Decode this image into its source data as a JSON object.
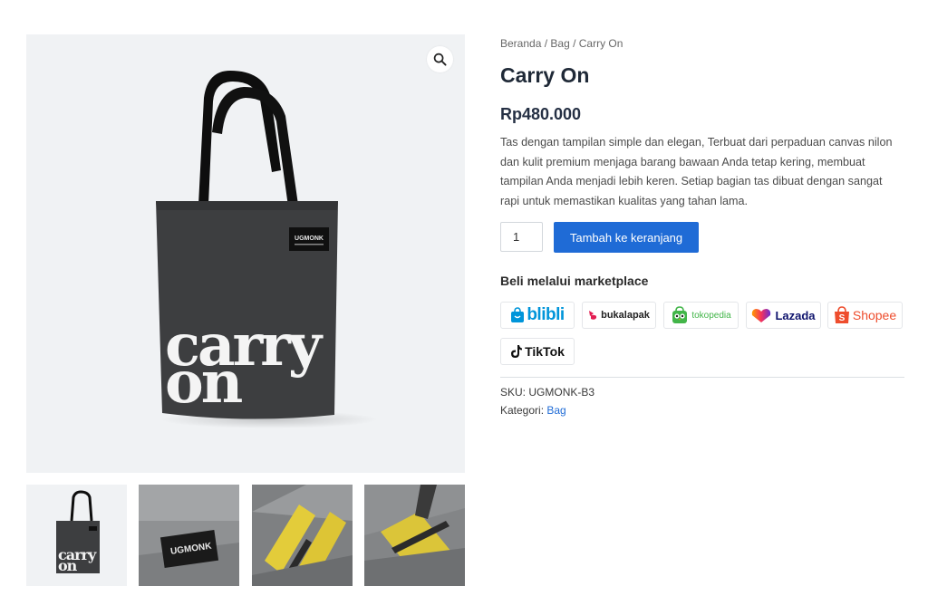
{
  "gallery": {
    "zoom_icon": "search-icon",
    "bag_brand_label": "UGMONK",
    "bag_print_line1": "carry",
    "bag_print_line2": "on"
  },
  "breadcrumb": {
    "home": "Beranda",
    "sep1": " / ",
    "category": "Bag",
    "sep2": " / ",
    "current": "Carry On"
  },
  "product": {
    "title": "Carry On",
    "price": "Rp480.000",
    "description": "Tas dengan tampilan simple dan elegan, Terbuat dari perpaduan canvas nilon dan kulit premium menjaga barang bawaan Anda tetap kering, membuat tampilan Anda menjadi lebih keren. Setiap bagian tas dibuat dengan sangat rapi untuk memastikan kualitas yang tahan lama.",
    "quantity": "1",
    "add_to_cart": "Tambah ke keranjang"
  },
  "marketplace": {
    "heading": "Beli melalui marketplace",
    "items": [
      {
        "label": "blibli",
        "color": "#0095da"
      },
      {
        "label": "bukalapak",
        "color": "#e31e52"
      },
      {
        "label": "tokopedia",
        "color": "#42b549"
      },
      {
        "label": "Lazada",
        "color": "#0f146d"
      },
      {
        "label": "Shopee",
        "color": "#ee4d2d"
      },
      {
        "label": "TikTok",
        "color": "#000000"
      }
    ]
  },
  "meta": {
    "sku_label": "SKU:",
    "sku_value": "UGMONK-B3",
    "category_label": "Kategori:",
    "category_value": "Bag"
  },
  "colors": {
    "accent": "#1f6bd6",
    "title": "#1f2937",
    "bag": "#3d3e40"
  }
}
